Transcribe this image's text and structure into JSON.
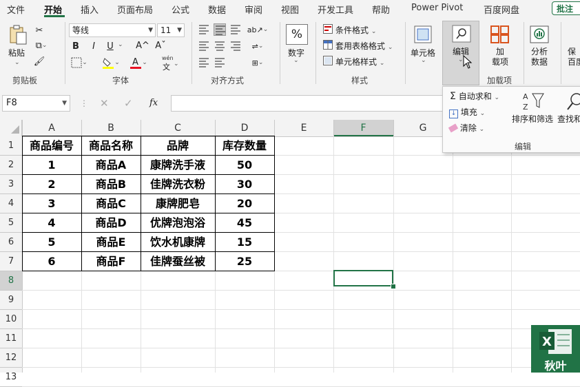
{
  "menu": {
    "tabs": [
      "文件",
      "开始",
      "插入",
      "页面布局",
      "公式",
      "数据",
      "审阅",
      "视图",
      "开发工具",
      "帮助",
      "Power Pivot",
      "百度网盘"
    ],
    "active": "开始",
    "comment_button": "批注"
  },
  "ribbon": {
    "clipboard": {
      "paste": "粘贴",
      "label": "剪贴板"
    },
    "font": {
      "name": "等线",
      "size": "11",
      "bold": "B",
      "italic": "I",
      "underline": "U",
      "grow": "A^",
      "shrink": "Aˇ",
      "wen": "wén",
      "wen_char": "文",
      "label": "字体"
    },
    "align": {
      "label": "对齐方式"
    },
    "number": {
      "label": "数字",
      "symbol": "%"
    },
    "styles": {
      "cond_format": "条件格式",
      "table_format": "套用表格格式",
      "cell_style": "单元格样式",
      "label": "样式"
    },
    "cells": {
      "label": "单元格"
    },
    "editing": {
      "label": "编辑"
    },
    "addins": {
      "label": "加载项",
      "btn": "加\n载项"
    },
    "analyze": {
      "label": "分析\n数据"
    },
    "partial": "保\n百度"
  },
  "edit_panel": {
    "autosum": "自动求和",
    "fill": "填充",
    "clear": "清除",
    "sort_filter": "排序和筛选",
    "find": "查找和",
    "label": "编辑"
  },
  "formula_bar": {
    "name_box": "F8",
    "fx": "fx",
    "content": ""
  },
  "columns": [
    "A",
    "B",
    "C",
    "D",
    "E",
    "F",
    "G"
  ],
  "rows": [
    "1",
    "2",
    "3",
    "4",
    "5",
    "6",
    "7",
    "8",
    "9",
    "10",
    "11",
    "12",
    "13"
  ],
  "table": {
    "headers": [
      "商品编号",
      "商品名称",
      "品牌",
      "库存数量"
    ],
    "rows": [
      [
        "1",
        "商品A",
        "康牌洗手液",
        "50"
      ],
      [
        "2",
        "商品B",
        "佳牌洗衣粉",
        "30"
      ],
      [
        "3",
        "商品C",
        "康牌肥皂",
        "20"
      ],
      [
        "4",
        "商品D",
        "优牌泡泡浴",
        "45"
      ],
      [
        "5",
        "商品E",
        "饮水机康牌",
        "15"
      ],
      [
        "6",
        "商品F",
        "佳牌蚕丝被",
        "25"
      ]
    ]
  },
  "selected_cell": "F8",
  "watermark": "秋叶",
  "colors": {
    "accent": "#217346",
    "ribbon_bg": "#f3f3f3",
    "grid": "#e1e1e1"
  }
}
